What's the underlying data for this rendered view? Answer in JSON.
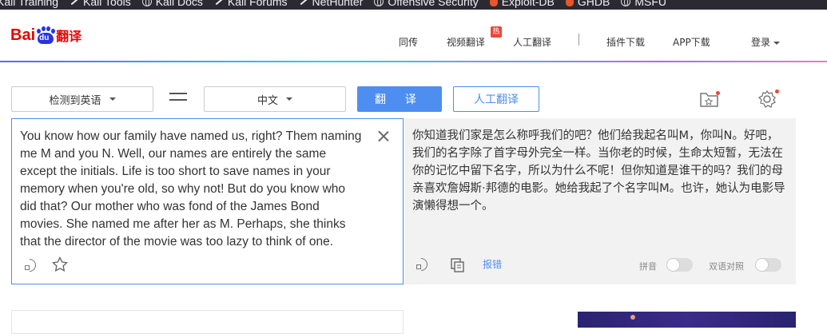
{
  "bookmarks": [
    {
      "label": "Kali Training",
      "icon": "none"
    },
    {
      "label": "Kali Tools",
      "icon": "kali-dragon-icon"
    },
    {
      "label": "Kali Docs",
      "icon": "globe-icon"
    },
    {
      "label": "Kali Forums",
      "icon": "kali-dragon-icon"
    },
    {
      "label": "NetHunter",
      "icon": "kali-dragon-icon"
    },
    {
      "label": "Offensive Security",
      "icon": "globe-icon"
    },
    {
      "label": "Exploit-DB",
      "icon": "fire-icon"
    },
    {
      "label": "GHDB",
      "icon": "fire-icon"
    },
    {
      "label": "MSFU",
      "icon": "globe-icon"
    }
  ],
  "header": {
    "logo_bai": "Bai",
    "logo_du": "du",
    "logo_fanyi": "翻译",
    "nav": {
      "tongchuan": "同传",
      "video": "视频翻译",
      "hot_badge": "热",
      "human": "人工翻译",
      "plugin": "插件下载",
      "app": "APP下载",
      "login": "登录"
    }
  },
  "toolbar": {
    "source_lang": "检测到英语",
    "target_lang": "中文",
    "translate_label": "翻 译",
    "human_translate_label": "人工翻译"
  },
  "source": {
    "text": "You know how our family have named us, right? Them naming me M and you N. Well, our names are entirely the same except the initials. Life is too short to save names in your memory when you're old, so why not! But do you know who did that? Our mother who was fond of the James Bond movies. She named me after her as M. Perhaps, she thinks that the director of the movie was too lazy to think of one."
  },
  "target": {
    "text": "你知道我们家是怎么称呼我们的吧？他们给我起名叫M，你叫N。好吧，我们的名字除了首字母外完全一样。当你老的时候，生命太短暂，无法在你的记忆中留下名字，所以为什么不呢！但你知道是谁干的吗？我们的母亲喜欢詹姆斯·邦德的电影。她给我起了个名字叫M。也许，她认为电影导演懒得想一个。",
    "report_label": "报错",
    "pinyin_label": "拼音",
    "bilingual_label": "双语对照"
  },
  "colors": {
    "accent": "#4e8ef0",
    "brand_red": "#e10601",
    "brand_blue": "#2932e1"
  }
}
